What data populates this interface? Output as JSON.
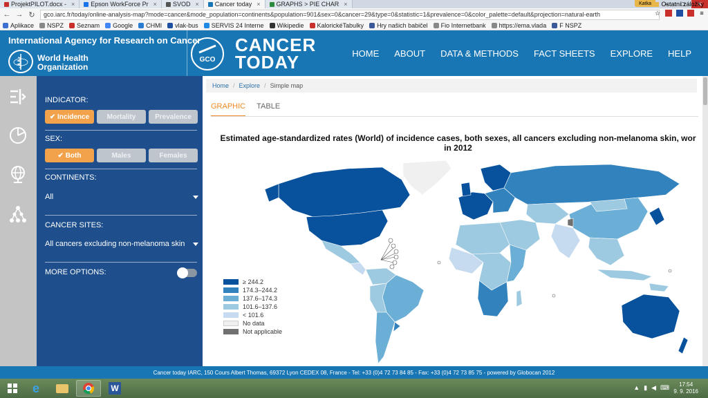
{
  "browser": {
    "tabs": [
      {
        "label": "ProjektPILOT.docx - ",
        "active": false
      },
      {
        "label": "Epson WorkForce Pr",
        "active": false
      },
      {
        "label": "SVOD",
        "active": false
      },
      {
        "label": "Cancer today",
        "active": true
      },
      {
        "label": "GRAPHS > PIE CHAR",
        "active": false
      }
    ],
    "user_badge": "Katka",
    "url": "gco.iarc.fr/today/online-analysis-map?mode=cancer&mode_population=continents&population=901&sex=0&cancer=29&type=0&statistic=1&prevalence=0&color_palette=default&projection=natural-earth",
    "bookmarks": [
      "Aplikace",
      "NSPZ",
      "Seznam",
      "Google",
      "CHMI",
      "vlak-bus",
      "SERVIS 24 Interne",
      "Wikipedie",
      "KalorickéTabulky",
      "Hry našich babičel",
      "Fio Internetbank",
      "https://ema.vlada",
      "F NSPZ"
    ],
    "bookmarks_other": "Ostatní záložky"
  },
  "header": {
    "iarc": "International Agency for Research on Cancer",
    "who_line1": "World Health",
    "who_line2": "Organization",
    "gco": "GCO",
    "brand_line1": "CANCER",
    "brand_line2": "TODAY",
    "nav": [
      "HOME",
      "ABOUT",
      "DATA & METHODS",
      "FACT SHEETS",
      "EXPLORE",
      "HELP"
    ]
  },
  "options": {
    "indicator_label": "INDICATOR:",
    "indicator_buttons": [
      "Incidence",
      "Mortality",
      "Prevalence"
    ],
    "sex_label": "SEX:",
    "sex_buttons": [
      "Both",
      "Males",
      "Females"
    ],
    "continents_label": "CONTINENTS:",
    "continents_value": "All",
    "cancer_label": "CANCER SITES:",
    "cancer_value": "All cancers excluding non-melanoma skin",
    "more_label": "MORE OPTIONS:"
  },
  "content": {
    "breadcrumb": [
      "Home",
      "Explore",
      "Simple map"
    ],
    "tabs": [
      "GRAPHIC",
      "TABLE"
    ],
    "title_line1": "Estimated age-standardized rates (World) of incidence cases, both sexes, all cancers excluding non-melanoma skin, wor",
    "title_line2": "in 2012",
    "legend": [
      {
        "label": "≥ 244.2",
        "color": "#08519c"
      },
      {
        "label": "174.3–244.2",
        "color": "#3182bd"
      },
      {
        "label": "137.6–174.3",
        "color": "#6baed6"
      },
      {
        "label": "101.6–137.6",
        "color": "#9ecae1"
      },
      {
        "label": "< 101.6",
        "color": "#c6dbef"
      },
      {
        "label": "No data",
        "color": "#f0f0f0"
      },
      {
        "label": "Not applicable",
        "color": "#707070"
      }
    ]
  },
  "footer": "Cancer today IARC, 150 Cours Albert Thomas, 69372 Lyon CEDEX 08, France - Tel: +33 (0)4 72 73 84 85 - Fax: +33 (0)4 72 73 85 75 - powered by Globocan 2012",
  "taskbar": {
    "time": "17:54",
    "date": "9. 9. 2016"
  }
}
